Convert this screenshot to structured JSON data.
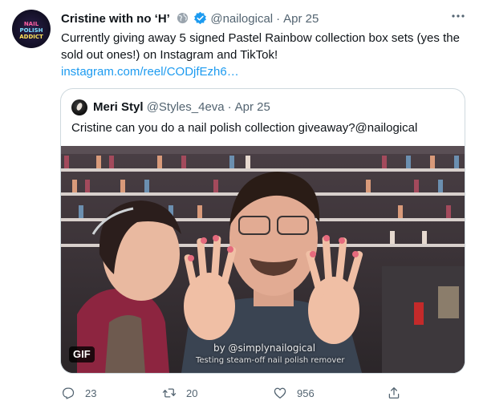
{
  "tweet": {
    "author": {
      "display_name": "Cristine with no ‘H’",
      "handle": "@nailogical",
      "avatar_text": [
        "NAIL",
        "POLISH",
        "ADDICT"
      ]
    },
    "separator": "·",
    "time": "Apr 25",
    "text": "Currently giving away 5 signed Pastel Rainbow collection box sets (yes the sold out ones!) on Instagram and TikTok!",
    "link": "instagram.com/reel/CODjfEzh6…",
    "more_icon": "more-horizontal-icon"
  },
  "quoted_tweet": {
    "display_name": "Meri Styl",
    "handle": "@Styles_4eva",
    "time": "Apr 25",
    "text": "Cristine can you do a nail polish collection giveaway?@nailogical",
    "media": {
      "badge": "GIF",
      "watermark": "by @simplynailogical",
      "caption": "Testing steam-off nail polish remover"
    }
  },
  "actions": {
    "reply": {
      "icon": "reply-icon",
      "count": "23"
    },
    "retweet": {
      "icon": "retweet-icon",
      "count": "20"
    },
    "like": {
      "icon": "heart-icon",
      "count": "956"
    },
    "share": {
      "icon": "share-icon"
    }
  },
  "colors": {
    "link": "#1d9bf0",
    "verified": "#1d9bf0",
    "muted": "#536471",
    "border": "#cfd9de"
  }
}
